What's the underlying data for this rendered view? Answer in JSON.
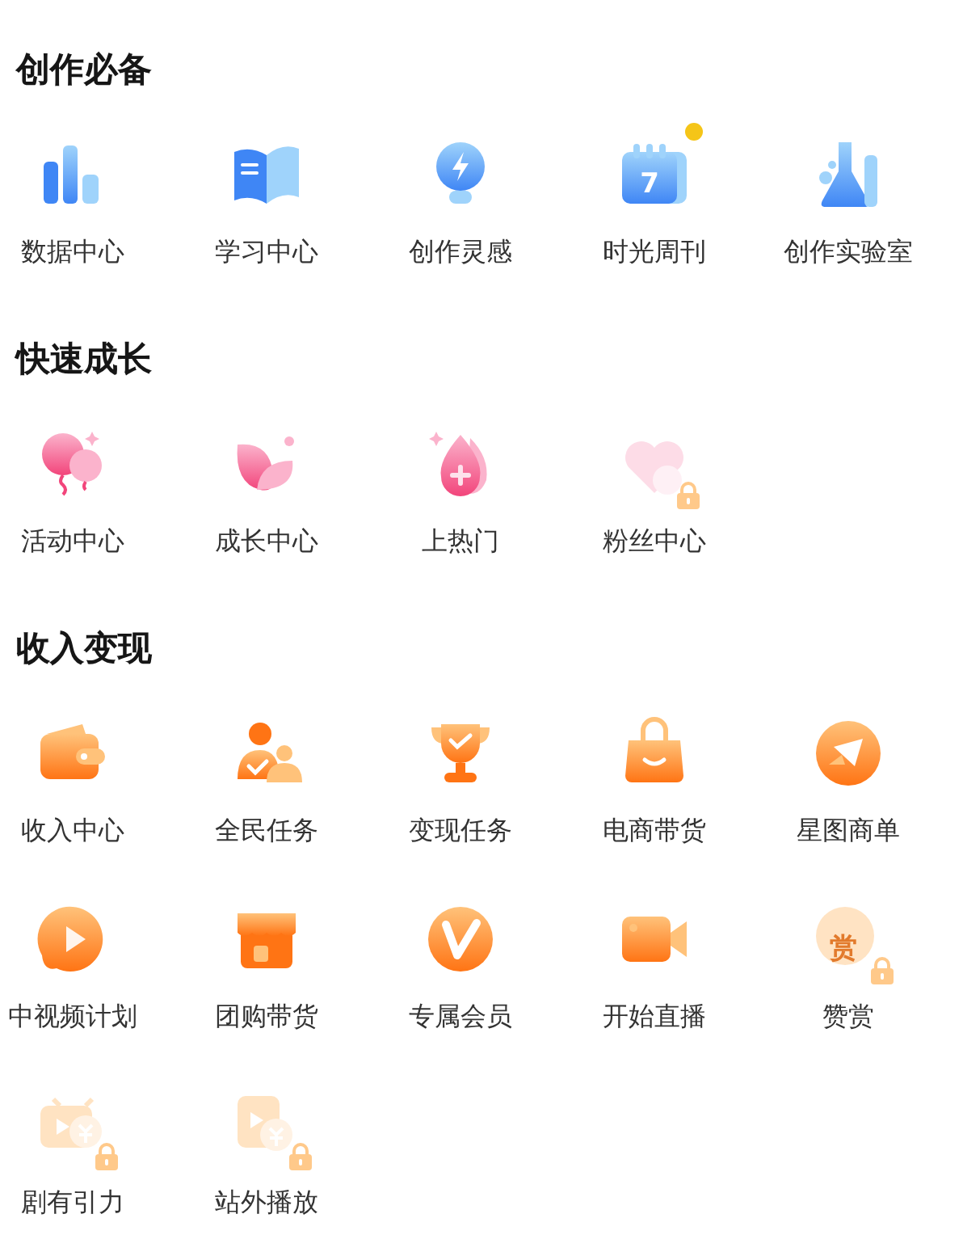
{
  "sections": [
    {
      "title": "创作必备",
      "items": [
        {
          "label": "数据中心",
          "locked": false,
          "dot": false
        },
        {
          "label": "学习中心",
          "locked": false,
          "dot": false
        },
        {
          "label": "创作灵感",
          "locked": false,
          "dot": false
        },
        {
          "label": "时光周刊",
          "locked": false,
          "dot": true,
          "icon_text": "7"
        },
        {
          "label": "创作实验室",
          "locked": false,
          "dot": false
        }
      ]
    },
    {
      "title": "快速成长",
      "items": [
        {
          "label": "活动中心",
          "locked": false,
          "dot": false
        },
        {
          "label": "成长中心",
          "locked": false,
          "dot": false
        },
        {
          "label": "上热门",
          "locked": false,
          "dot": false
        },
        {
          "label": "粉丝中心",
          "locked": true,
          "dot": false
        }
      ]
    },
    {
      "title": "收入变现",
      "items": [
        {
          "label": "收入中心",
          "locked": false,
          "dot": false
        },
        {
          "label": "全民任务",
          "locked": false,
          "dot": false
        },
        {
          "label": "变现任务",
          "locked": false,
          "dot": false
        },
        {
          "label": "电商带货",
          "locked": false,
          "dot": false
        },
        {
          "label": "星图商单",
          "locked": false,
          "dot": false
        },
        {
          "label": "中视频计划",
          "locked": false,
          "dot": false
        },
        {
          "label": "团购带货",
          "locked": false,
          "dot": false
        },
        {
          "label": "专属会员",
          "locked": false,
          "dot": false
        },
        {
          "label": "开始直播",
          "locked": false,
          "dot": false
        },
        {
          "label": "赞赏",
          "locked": true,
          "dot": false,
          "icon_text": "赏"
        },
        {
          "label": "剧有引力",
          "locked": true,
          "dot": false
        },
        {
          "label": "站外播放",
          "locked": true,
          "dot": false
        }
      ]
    }
  ]
}
